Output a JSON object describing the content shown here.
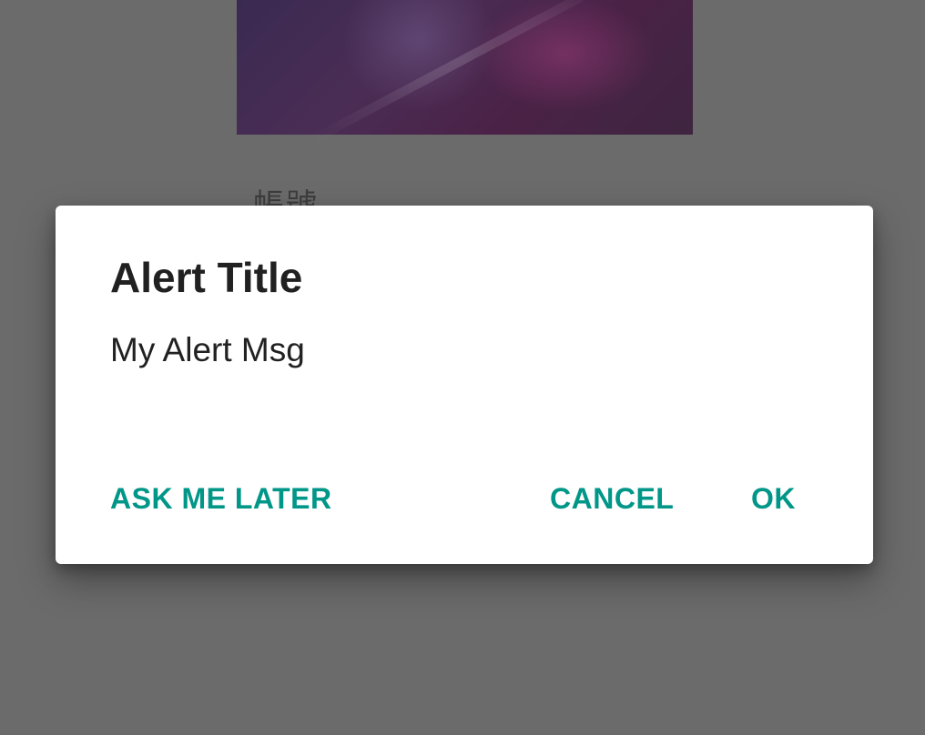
{
  "background": {
    "label_partial": "帳號"
  },
  "dialog": {
    "title": "Alert Title",
    "message": "My Alert Msg",
    "buttons": {
      "neutral": "ASK ME LATER",
      "negative": "CANCEL",
      "positive": "OK"
    }
  },
  "colors": {
    "accent": "#009688",
    "scrim": "#6b6b6b",
    "dialog_bg": "#ffffff",
    "text_primary": "#212121"
  }
}
